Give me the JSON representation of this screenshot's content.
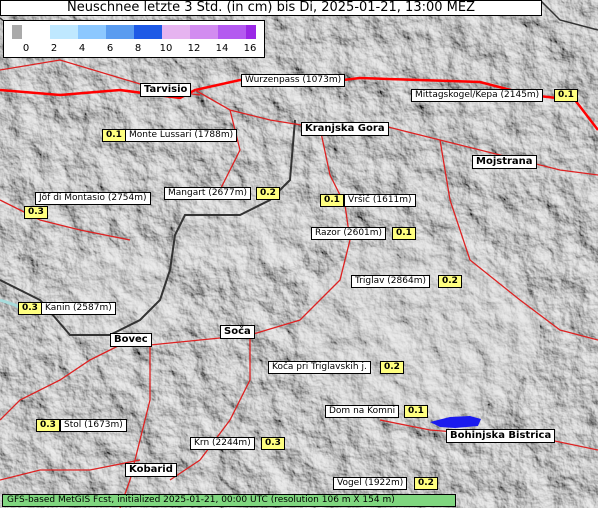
{
  "title": "Neuschnee letzte 3 Std. (in cm) bis Di, 2025-01-21, 13:00 MEZ",
  "legend": {
    "ticks": [
      "0",
      "2",
      "4",
      "6",
      "8",
      "10",
      "12",
      "14",
      "16"
    ],
    "colors": [
      "#ffffff",
      "#bfe8ff",
      "#8cc8ff",
      "#5a9cf0",
      "#1e5ae6",
      "#e6b4f0",
      "#d28cf0",
      "#b45af0",
      "#9b28e6"
    ],
    "leftcap_color": "#aaaaaa"
  },
  "towns": [
    "Tarvisio",
    "Kranjska Gora",
    "Mojstrana",
    "Bovec",
    "Soča",
    "Bohinjska Bistrica",
    "Kobarid"
  ],
  "stations": [
    {
      "name": "Wurzenpass (1073m)",
      "value": ""
    },
    {
      "name": "Mittagskogel/Kepa (2145m)",
      "value": "0.1"
    },
    {
      "name": "Monte Lussari (1788m)",
      "value": "0.1"
    },
    {
      "name": "Jôf di Montasio (2754m)",
      "value": "0.3"
    },
    {
      "name": "Mangart (2677m)",
      "value": "0.2"
    },
    {
      "name": "Vršič (1611m)",
      "value": "0.1"
    },
    {
      "name": "Razor (2601m)",
      "value": "0.1"
    },
    {
      "name": "Triglav (2864m)",
      "value": "0.2"
    },
    {
      "name": "Kanin (2587m)",
      "value": "0.3"
    },
    {
      "name": "Koča pri Triglavskih j.",
      "value": "0.2"
    },
    {
      "name": "Dom na Komni",
      "value": "0.1"
    },
    {
      "name": "Stol (1673m)",
      "value": "0.3"
    },
    {
      "name": "Krn (2244m)",
      "value": "0.3"
    },
    {
      "name": "Vogel (1922m)",
      "value": "0.2"
    }
  ],
  "footer": "GFS-based MetGIS Fcst, initialized 2025-01-21, 00:00 UTC  (resolution 106 m X 154 m)"
}
